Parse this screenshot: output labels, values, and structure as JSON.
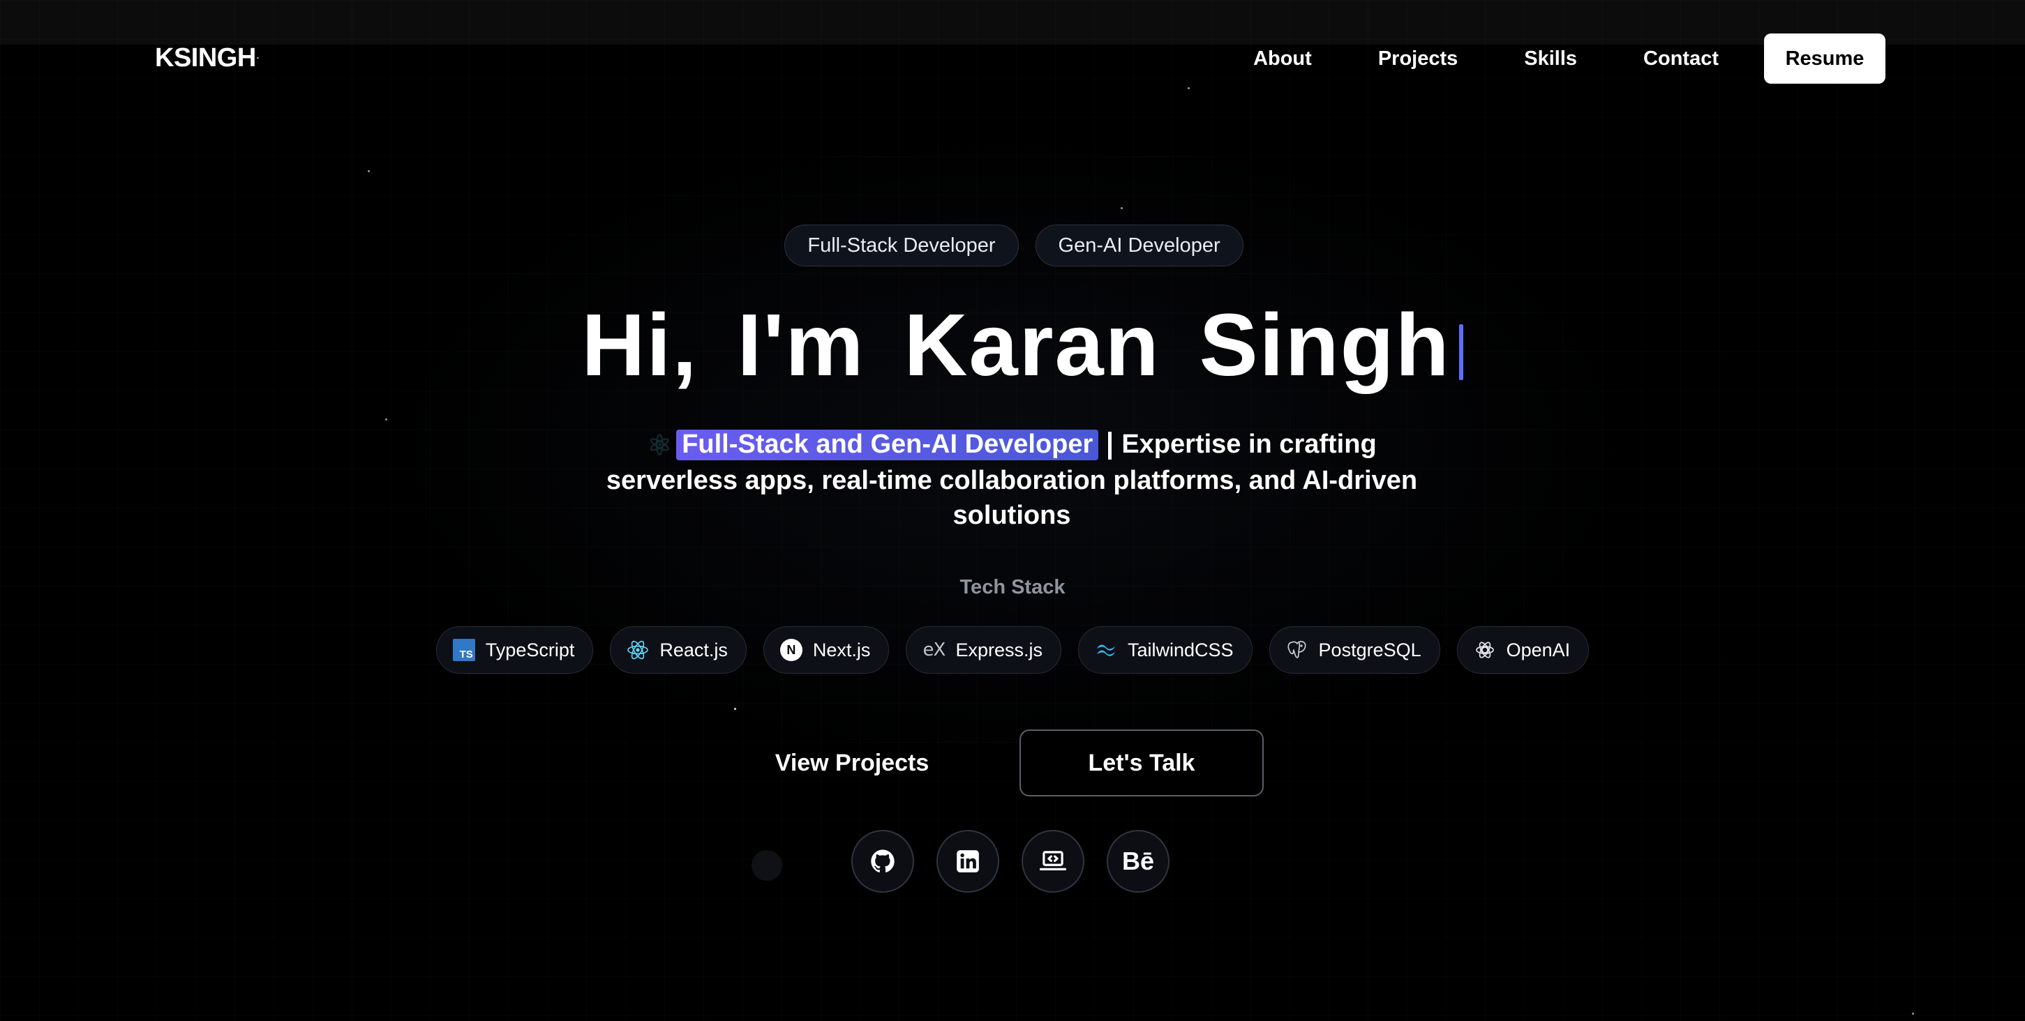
{
  "nav": {
    "logo": "KSINGH",
    "logo_mark": "·",
    "links": [
      "About",
      "Projects",
      "Skills",
      "Contact"
    ],
    "resume_label": "Resume"
  },
  "hero": {
    "badges": [
      "Full-Stack Developer",
      "Gen-AI Developer"
    ],
    "greeting_words": [
      "Hi,",
      "I'm",
      "Karan",
      "Singh"
    ],
    "highlight": "Full-Stack and Gen-AI Developer",
    "description": "Expertise in crafting serverless apps, real-time collaboration platforms, and AI-driven solutions"
  },
  "tech_stack": {
    "label": "Tech Stack",
    "items": [
      {
        "name": "TypeScript",
        "icon": "typescript-icon"
      },
      {
        "name": "React.js",
        "icon": "react-icon"
      },
      {
        "name": "Next.js",
        "icon": "nextjs-icon"
      },
      {
        "name": "Express.js",
        "icon": "express-icon"
      },
      {
        "name": "TailwindCSS",
        "icon": "tailwind-icon"
      },
      {
        "name": "PostgreSQL",
        "icon": "postgresql-icon"
      },
      {
        "name": "OpenAI",
        "icon": "openai-icon"
      }
    ],
    "ts_glyph": "TS",
    "next_glyph": "N",
    "express_glyph": "eX"
  },
  "cta": {
    "view_projects": "View Projects",
    "lets_talk": "Let's Talk"
  },
  "socials": {
    "icons": [
      "github-icon",
      "linkedin-icon",
      "portfolio-laptop-icon",
      "behance-icon"
    ],
    "behance_glyph": "Bē"
  },
  "colors": {
    "background": "#000000",
    "accent": "#5b6fff",
    "highlight_start": "#6a5cf0",
    "highlight_end": "#4958d6",
    "badge_bg": "#0f131b",
    "badge_border": "#2b3240"
  }
}
